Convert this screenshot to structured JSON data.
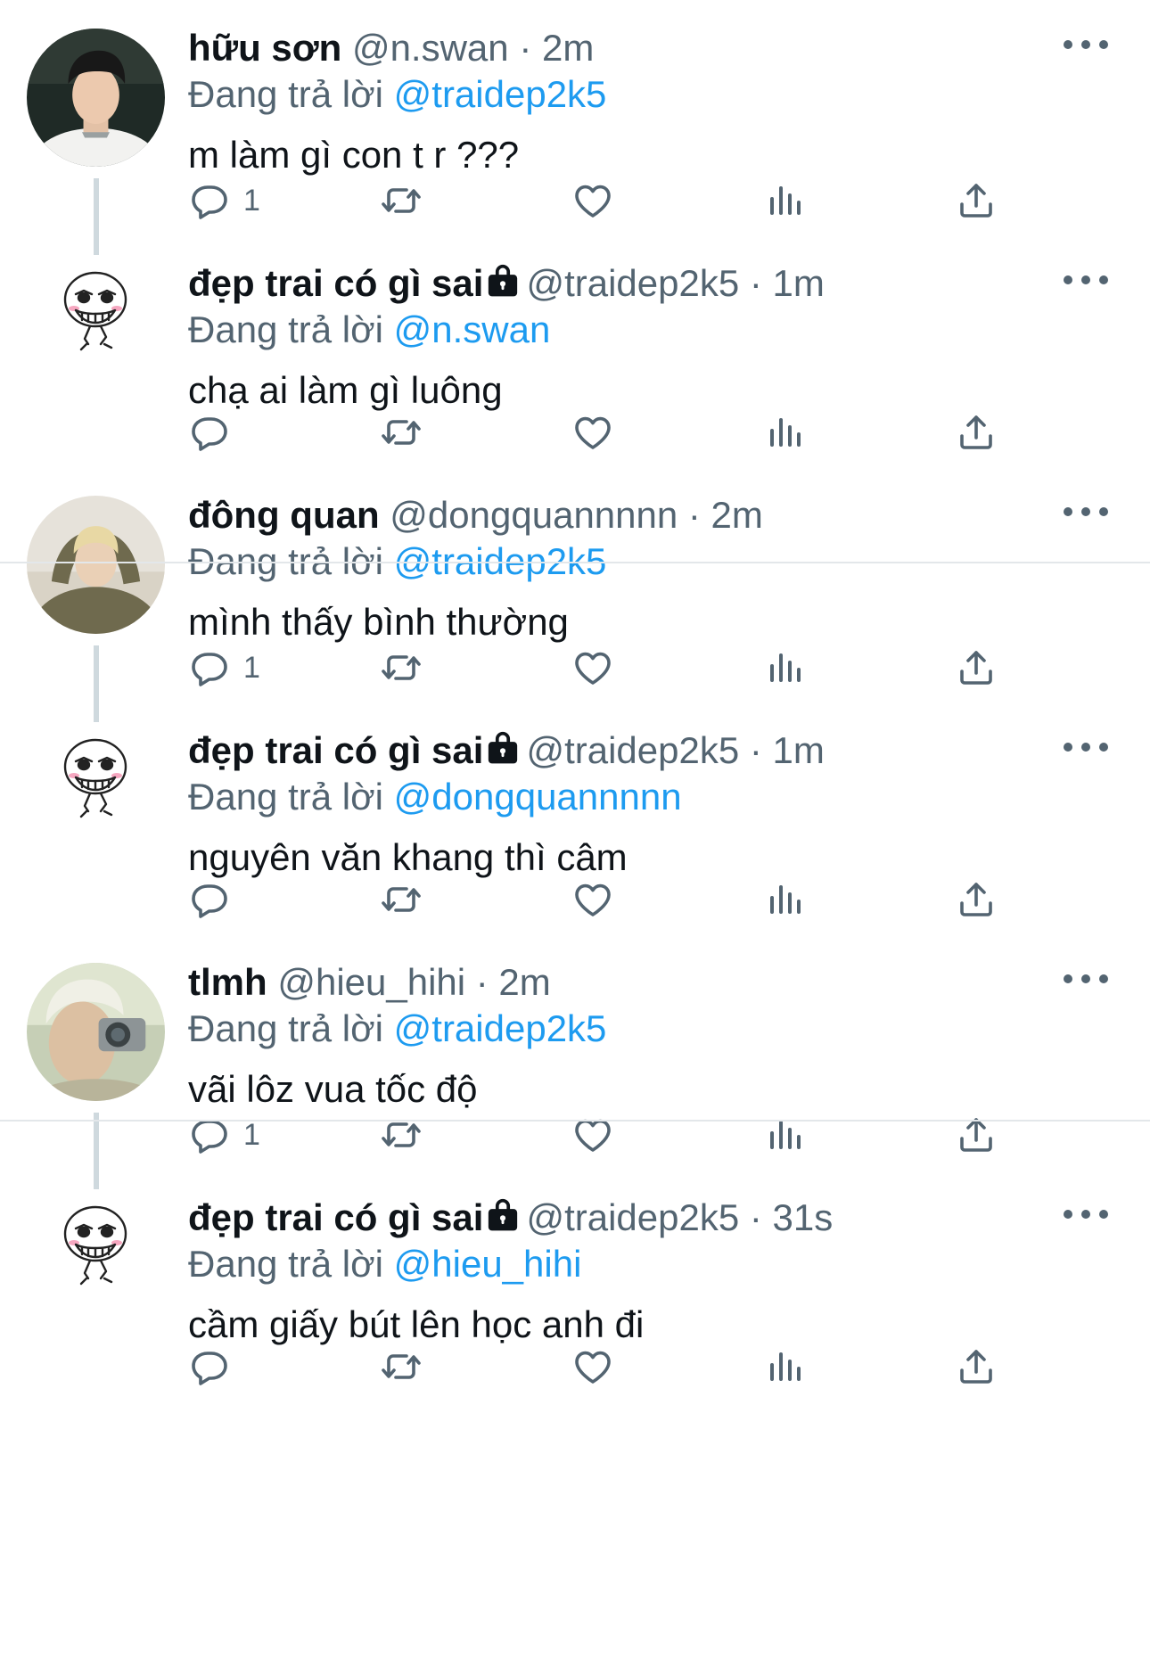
{
  "colors": {
    "accent": "#1d9bf0",
    "secondary_text": "#536471",
    "primary_text": "#0f1419",
    "thread_line": "#cfd9de",
    "divider": "#e3e7ea"
  },
  "icons": {
    "reply": "reply-icon",
    "retweet": "retweet-icon",
    "like": "heart-icon",
    "views": "views-icon",
    "share": "share-icon",
    "more": "more-icon",
    "lock": "lock-icon"
  },
  "tweets": [
    {
      "name": "hữu sơn",
      "handle": "@n.swan",
      "time": "· 2m",
      "reply_prefix": "Đang trả lời",
      "reply_to": "@traidep2k5",
      "text": "m làm gì con t r ???",
      "reply_count": "1"
    },
    {
      "name": "đẹp trai có gì sai",
      "handle": "@traidep2k5",
      "time": "· 1m",
      "reply_prefix": "Đang trả lời",
      "reply_to": "@n.swan",
      "text": "chạ ai làm gì luông"
    },
    {
      "name": "đông quan",
      "handle": "@dongquannnnn",
      "time": "· 2m",
      "reply_prefix": "Đang trả lời",
      "reply_to": "@traidep2k5",
      "text": "mình thấy bình thường",
      "reply_count": "1"
    },
    {
      "name": "đẹp trai có gì sai",
      "handle": "@traidep2k5",
      "time": "· 1m",
      "reply_prefix": "Đang trả lời",
      "reply_to": "@dongquannnnn",
      "text": "nguyên văn khang thì câm"
    },
    {
      "name": "tlmh",
      "handle": "@hieu_hihi",
      "time": "· 2m",
      "reply_prefix": "Đang trả lời",
      "reply_to": "@traidep2k5",
      "text": "vãi lôz vua tốc độ",
      "reply_count": "1"
    },
    {
      "name": "đẹp trai có gì sai",
      "handle": "@traidep2k5",
      "time": "· 31s",
      "reply_prefix": "Đang trả lời",
      "reply_to": "@hieu_hihi",
      "text": "cầm giấy bút lên học anh đi"
    }
  ]
}
